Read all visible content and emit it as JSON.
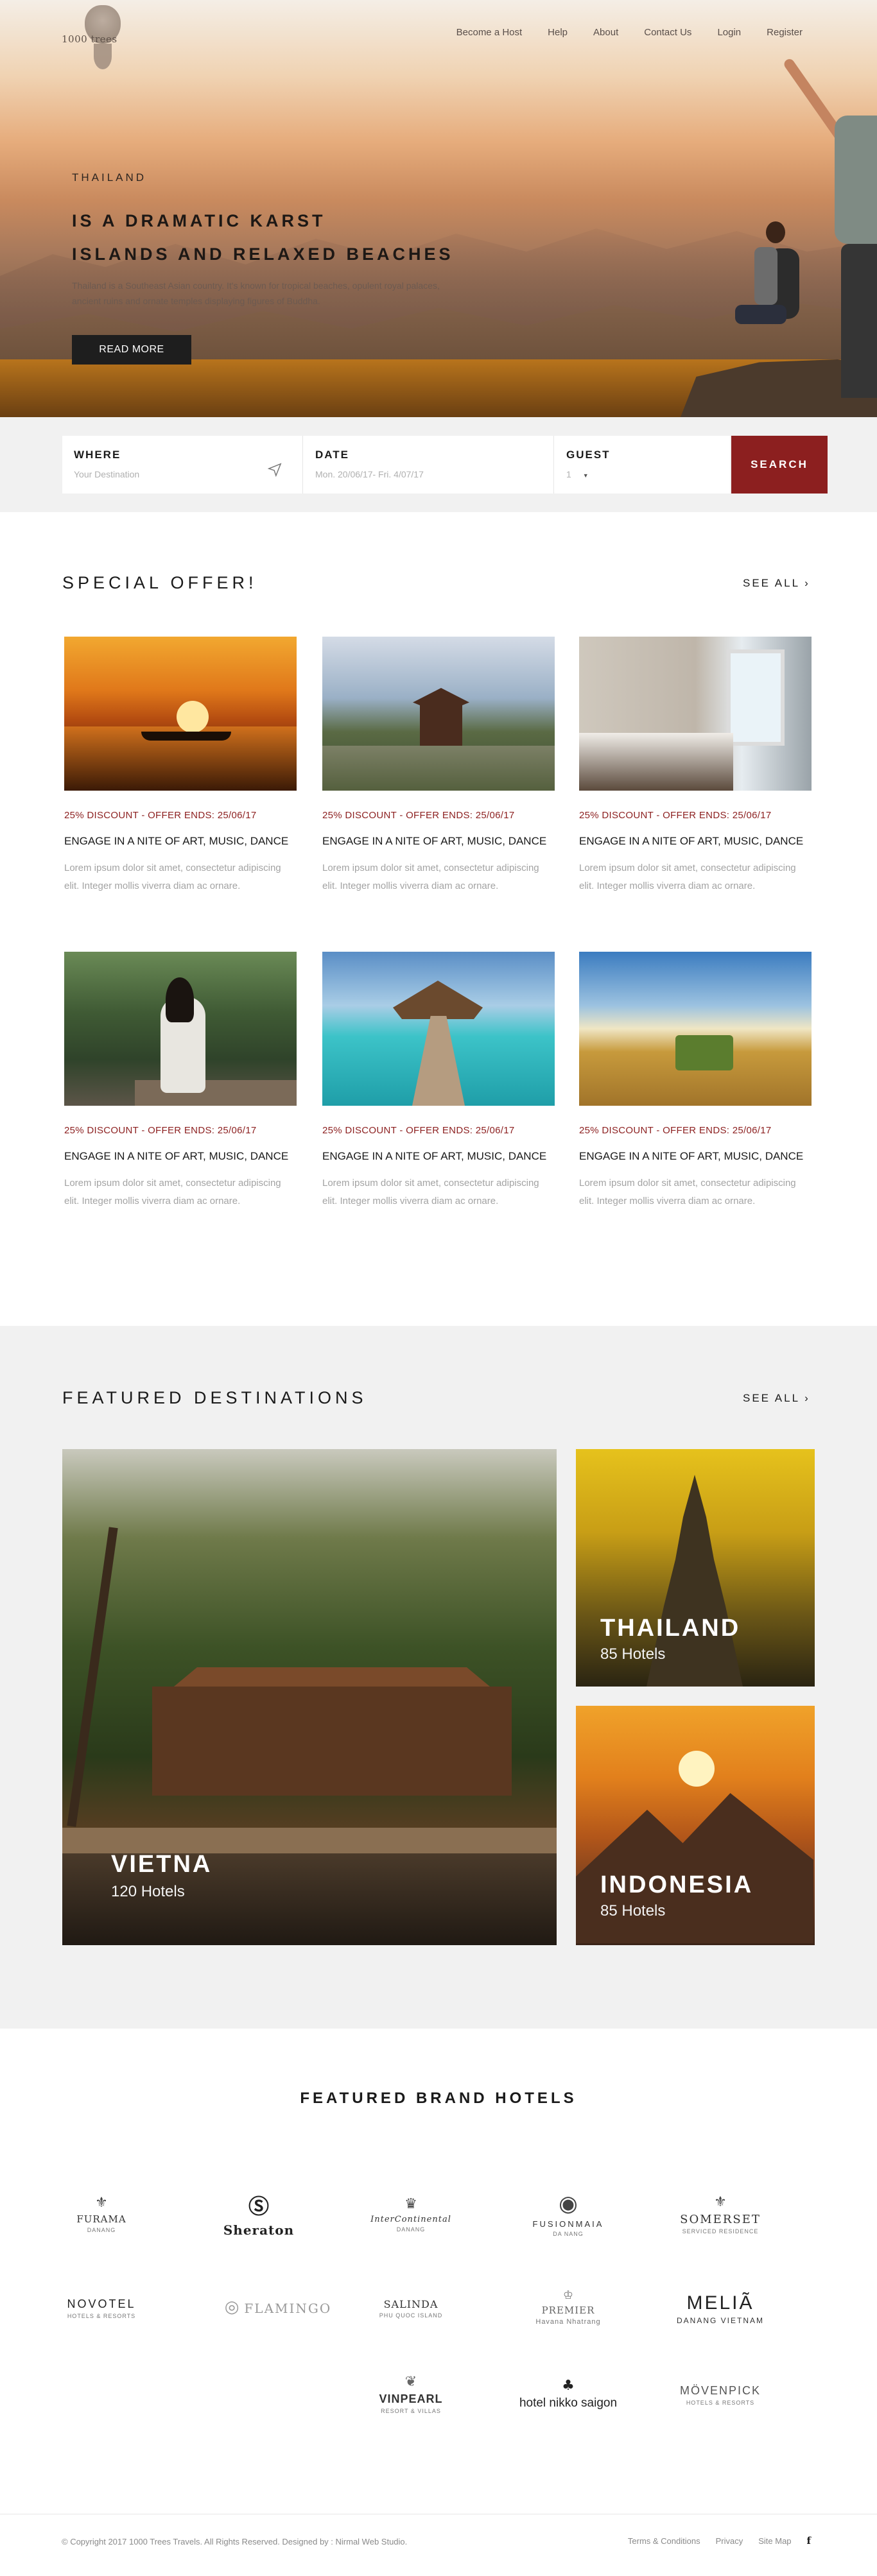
{
  "brand": {
    "logo_text": "1000 trees"
  },
  "nav": {
    "items": [
      "Become a Host",
      "Help",
      "About",
      "Contact Us",
      "Login",
      "Register"
    ]
  },
  "hero": {
    "country": "THAILAND",
    "title_line1": "IS A DRAMATIC KARST",
    "title_line2": "ISLANDS AND RELAXED BEACHES",
    "description": "Thailand is a Southeast Asian country. It's known for tropical beaches, opulent royal palaces, ancient ruins and ornate temples displaying figures of Buddha.",
    "cta": "READ MORE"
  },
  "search": {
    "where_label": "WHERE",
    "where_placeholder": "Your Destination",
    "date_label": "DATE",
    "date_value": "Mon. 20/06/17- Fri. 4/07/17",
    "guest_label": "GUEST",
    "guest_value": "1",
    "button": "SEARCH"
  },
  "special_offer": {
    "title": "SPECIAL OFFER!",
    "see_all": "SEE ALL",
    "cards": [
      {
        "discount": "25% DISCOUNT - OFFER ENDS: 25/06/17",
        "title": "ENGAGE IN A NITE OF ART, MUSIC, DANCE",
        "text": "Lorem ipsum dolor sit amet, consectetur adipiscing elit. Integer mollis viverra diam ac ornare."
      },
      {
        "discount": "25% DISCOUNT - OFFER ENDS: 25/06/17",
        "title": "ENGAGE IN A NITE OF ART, MUSIC, DANCE",
        "text": "Lorem ipsum dolor sit amet, consectetur adipiscing elit. Integer mollis viverra diam ac ornare."
      },
      {
        "discount": "25% DISCOUNT - OFFER ENDS: 25/06/17",
        "title": "ENGAGE IN A NITE OF ART, MUSIC, DANCE",
        "text": "Lorem ipsum dolor sit amet, consectetur adipiscing elit. Integer mollis viverra diam ac ornare."
      },
      {
        "discount": "25% DISCOUNT - OFFER ENDS: 25/06/17",
        "title": "ENGAGE IN A NITE OF ART, MUSIC, DANCE",
        "text": "Lorem ipsum dolor sit amet, consectetur adipiscing elit. Integer mollis viverra diam ac ornare."
      },
      {
        "discount": "25% DISCOUNT - OFFER ENDS: 25/06/17",
        "title": "ENGAGE IN A NITE OF ART, MUSIC, DANCE",
        "text": "Lorem ipsum dolor sit amet, consectetur adipiscing elit. Integer mollis viverra diam ac ornare."
      },
      {
        "discount": "25% DISCOUNT - OFFER ENDS: 25/06/17",
        "title": "ENGAGE IN A NITE OF ART, MUSIC, DANCE",
        "text": "Lorem ipsum dolor sit amet, consectetur adipiscing elit. Integer mollis viverra diam ac ornare."
      }
    ]
  },
  "featured": {
    "title": "FEATURED DESTINATIONS",
    "see_all": "SEE ALL",
    "destinations": [
      {
        "name": "VIETNA",
        "hotels": "120 Hotels"
      },
      {
        "name": "THAILAND",
        "hotels": "85 Hotels"
      },
      {
        "name": "INDONESIA",
        "hotels": "85 Hotels"
      }
    ]
  },
  "brands": {
    "title": "FEATURED BRAND HOTELS",
    "items": [
      {
        "name": "FURAMA",
        "sub": "DANANG"
      },
      {
        "name": "Sheraton",
        "sub": ""
      },
      {
        "name": "InterContinental",
        "sub": "DANANG"
      },
      {
        "name": "FUSIONMAIA",
        "sub": "DA NANG"
      },
      {
        "name": "SOMERSET",
        "sub": "SERVICED RESIDENCE"
      },
      {
        "name": "NOVOTEL",
        "sub": "HOTELS & RESORTS"
      },
      {
        "name": "FLAMINGO",
        "sub": ""
      },
      {
        "name": "SALINDA",
        "sub": "PHU QUOC ISLAND"
      },
      {
        "name": "PREMIER",
        "sub": "Havana Nhatrang"
      },
      {
        "name": "MELIÃ",
        "sub": "DANANG VIETNAM"
      },
      {
        "name": "VINPEARL",
        "sub": "RESORT & VILLAS"
      },
      {
        "name": "hotel nikko saigon",
        "sub": ""
      },
      {
        "name": "MÖVENPICK",
        "sub": "HOTELS & RESORTS"
      }
    ]
  },
  "footer": {
    "copyright": "© Copyright 2017 1000 Trees Travels. All Rights Reserved. Designed by : Nirmal Web Studio.",
    "links": [
      "Terms & Conditions",
      "Privacy",
      "Site Map"
    ],
    "social": "f"
  },
  "colors": {
    "accent": "#8c1f1f",
    "dark": "#1e1e1e",
    "gray_bg": "#f1f1f1",
    "muted_text": "#a3a3a3"
  }
}
